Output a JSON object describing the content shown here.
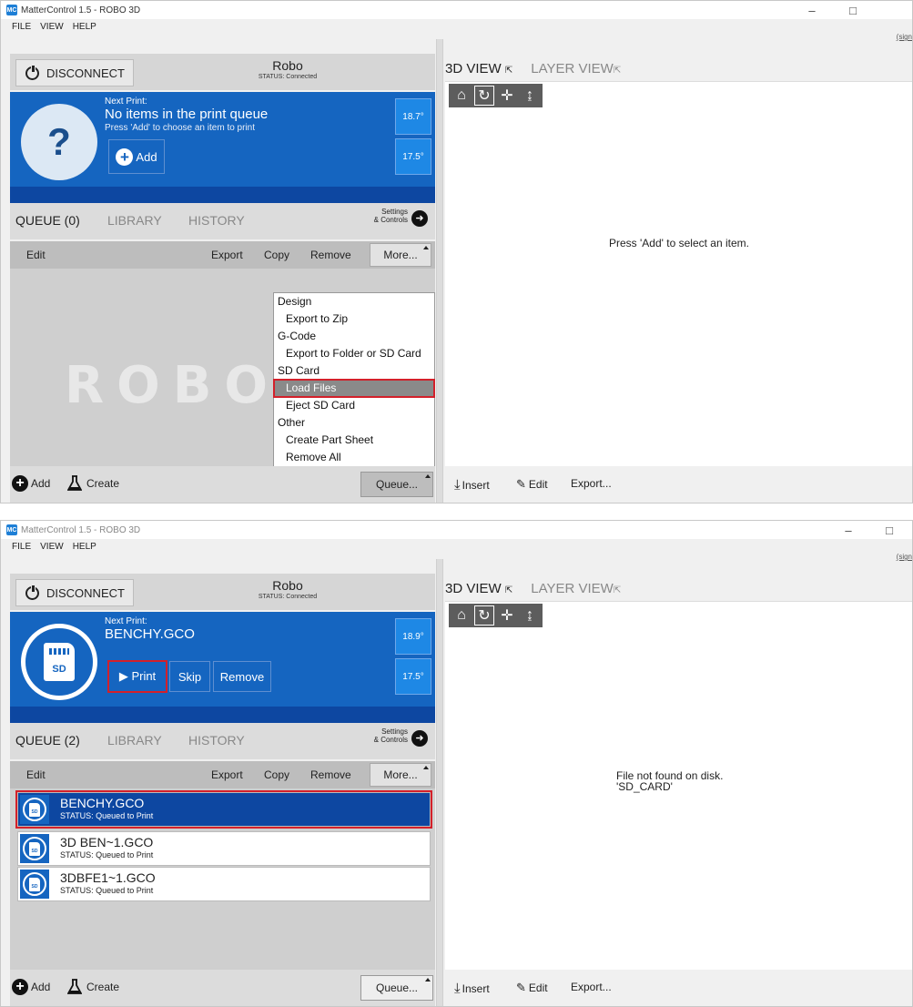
{
  "window": {
    "title": "MatterControl 1.5 - ROBO 3D",
    "app_icon": "MC",
    "min": "–",
    "max": "□",
    "close": "×",
    "menu": [
      "FILE",
      "VIEW",
      "HELP"
    ],
    "sign_link": "(sign"
  },
  "printer": {
    "disconnect_label": "DISCONNECT",
    "name": "Robo",
    "status": "STATUS: Connected"
  },
  "tabs": {
    "library": "LIBRARY",
    "history": "HISTORY",
    "settings_line1": "Settings",
    "settings_line2": "& Controls"
  },
  "toolbar": {
    "edit": "Edit",
    "export": "Export",
    "copy": "Copy",
    "remove": "Remove",
    "more": "More..."
  },
  "bottom": {
    "add": "Add",
    "create": "Create",
    "queue": "Queue..."
  },
  "view": {
    "tab_3d": "3D VIEW",
    "tab_layer": "LAYER VIEW",
    "insert": "Insert",
    "edit": "Edit",
    "export": "Export..."
  },
  "screen1": {
    "next_label": "Next Print:",
    "next_title": "No items in the print queue",
    "next_sub": "Press 'Add' to choose an item to print",
    "add_button": "Add",
    "temp1": "18.7°",
    "temp2": "17.5°",
    "queue_tab": "QUEUE (0)",
    "logo_text": "ROBO",
    "view_message": "Press 'Add' to select an item.",
    "more_menu": [
      {
        "label": "Design",
        "type": "header"
      },
      {
        "label": "Export to Zip",
        "type": "item"
      },
      {
        "label": "G-Code",
        "type": "header"
      },
      {
        "label": "Export to Folder or SD Card",
        "type": "item"
      },
      {
        "label": "SD Card",
        "type": "header"
      },
      {
        "label": "Load Files",
        "type": "item",
        "highlighted": true
      },
      {
        "label": "Eject SD Card",
        "type": "item"
      },
      {
        "label": "Other",
        "type": "header"
      },
      {
        "label": "Create Part Sheet",
        "type": "item"
      },
      {
        "label": "Remove All",
        "type": "item"
      }
    ]
  },
  "screen2": {
    "next_label": "Next Print:",
    "next_title": "BENCHY.GCO",
    "sd_label": "SD",
    "print_button": "▶ Print",
    "skip_button": "Skip",
    "remove_button": "Remove",
    "temp1": "18.9°",
    "temp2": "17.5°",
    "queue_tab": "QUEUE (2)",
    "view_message_line1": "File not found on disk.",
    "view_message_line2": "'SD_CARD'",
    "queue_items": [
      {
        "name": "BENCHY.GCO",
        "status": "STATUS: Queued to Print",
        "selected": true
      },
      {
        "name": "3D BEN~1.GCO",
        "status": "STATUS: Queued to Print",
        "selected": false
      },
      {
        "name": "3DBFE1~1.GCO",
        "status": "STATUS: Queued to Print",
        "selected": false
      }
    ]
  }
}
